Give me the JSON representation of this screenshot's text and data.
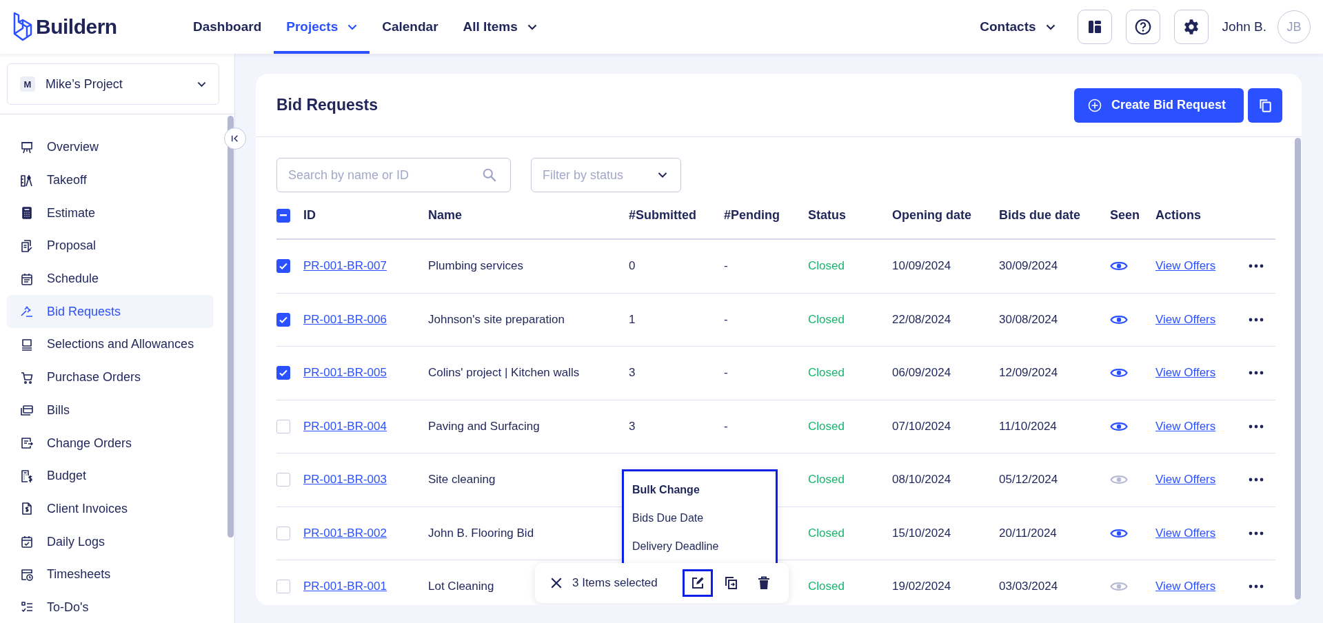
{
  "topbar": {
    "logo": "Buildern",
    "nav": [
      {
        "label": "Dashboard",
        "selected": false,
        "dropdown": false
      },
      {
        "label": "Projects",
        "selected": true,
        "dropdown": true
      },
      {
        "label": "Calendar",
        "selected": false,
        "dropdown": false
      },
      {
        "label": "All Items",
        "selected": false,
        "dropdown": true
      }
    ],
    "contacts": "Contacts",
    "user": "John B.",
    "initials": "JB"
  },
  "sidebar": {
    "project": {
      "badge": "M",
      "name": "Mike’s Project"
    },
    "items": [
      {
        "label": "Overview",
        "kind": "easel",
        "selected": false
      },
      {
        "label": "Takeoff",
        "kind": "compass",
        "selected": false
      },
      {
        "label": "Estimate",
        "kind": "calculator",
        "selected": false
      },
      {
        "label": "Proposal",
        "kind": "document",
        "selected": false
      },
      {
        "label": "Schedule",
        "kind": "calendar",
        "selected": false
      },
      {
        "label": "Bid Requests",
        "kind": "gavel",
        "selected": true
      },
      {
        "label": "Selections and Allowances",
        "kind": "laptop",
        "selected": false
      },
      {
        "label": "Purchase Orders",
        "kind": "cart",
        "selected": false
      },
      {
        "label": "Bills",
        "kind": "cards",
        "selected": false
      },
      {
        "label": "Change Orders",
        "kind": "change",
        "selected": false
      },
      {
        "label": "Budget",
        "kind": "budget",
        "selected": false
      },
      {
        "label": "Client Invoices",
        "kind": "invoice",
        "selected": false
      },
      {
        "label": "Daily Logs",
        "kind": "check",
        "selected": false
      },
      {
        "label": "Timesheets",
        "kind": "clock",
        "selected": false
      },
      {
        "label": "To-Do's",
        "kind": "todo",
        "selected": false
      }
    ]
  },
  "page": {
    "title": "Bid Requests",
    "create_button": "Create Bid Request",
    "search": {
      "placeholder": "Search by name or ID"
    },
    "filter": {
      "placeholder": "Filter by status"
    },
    "table": {
      "select_all_partial": true,
      "columns": [
        "ID",
        "Name",
        "#Submitted",
        "#Pending",
        "Status",
        "Opening date",
        "Bids due date",
        "Seen",
        "Actions"
      ],
      "rows": [
        {
          "checked": true,
          "id": "PR-001-BR-007",
          "name": "Plumbing services",
          "submitted": "0",
          "pending": "-",
          "status": "Closed",
          "opening": "10/09/2024",
          "due": "30/09/2024",
          "seen": true,
          "action": "View Offers"
        },
        {
          "checked": true,
          "id": "PR-001-BR-006",
          "name": "Johnson's site preparation",
          "submitted": "1",
          "pending": "-",
          "status": "Closed",
          "opening": "22/08/2024",
          "due": "30/08/2024",
          "seen": true,
          "action": "View Offers"
        },
        {
          "checked": true,
          "id": "PR-001-BR-005",
          "name": "Colins' project | Kitchen walls",
          "submitted": "3",
          "pending": "-",
          "status": "Closed",
          "opening": "06/09/2024",
          "due": "12/09/2024",
          "seen": true,
          "action": "View Offers"
        },
        {
          "checked": false,
          "id": "PR-001-BR-004",
          "name": "Paving and Surfacing",
          "submitted": "3",
          "pending": "-",
          "status": "Closed",
          "opening": "07/10/2024",
          "due": "11/10/2024",
          "seen": true,
          "action": "View Offers"
        },
        {
          "checked": false,
          "id": "PR-001-BR-003",
          "name": "Site cleaning",
          "status": "Closed",
          "opening": "08/10/2024",
          "due": "05/12/2024",
          "seen": false,
          "action": "View Offers"
        },
        {
          "checked": false,
          "id": "PR-001-BR-002",
          "name": "John B. Flooring Bid",
          "status": "Closed",
          "opening": "15/10/2024",
          "due": "20/11/2024",
          "seen": true,
          "action": "View Offers"
        },
        {
          "checked": false,
          "id": "PR-001-BR-001",
          "name": "Lot Cleaning",
          "status": "Closed",
          "opening": "19/02/2024",
          "due": "03/03/2024",
          "seen": false,
          "action": "View Offers"
        }
      ]
    },
    "bulk_menu": {
      "title": "Bulk Change",
      "highlighted": true,
      "options": [
        "Bids Due Date",
        "Delivery Deadline"
      ]
    },
    "selection_bar": {
      "count": "3 Items selected",
      "tools": [
        {
          "kind": "edit",
          "highlighted": true
        },
        {
          "kind": "copy",
          "highlighted": false
        },
        {
          "kind": "delete",
          "highlighted": false
        }
      ]
    }
  }
}
